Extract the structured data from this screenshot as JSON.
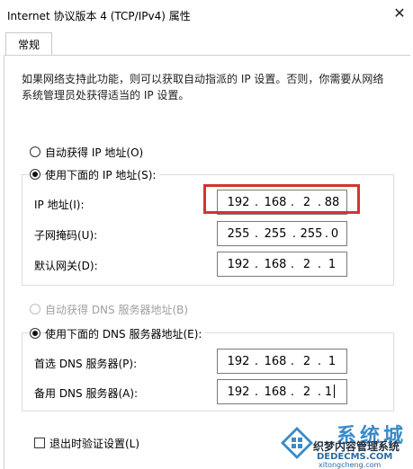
{
  "window": {
    "title": "Internet 协议版本 4 (TCP/IPv4) 属性",
    "close_glyph": "✕"
  },
  "tabs": [
    {
      "label": "常规",
      "selected": true
    }
  ],
  "description": "如果网络支持此功能，则可以获取自动指派的 IP 设置。否则，你需要从网络系统管理员处获得适当的 IP 设置。",
  "ip_section": {
    "auto_radio": {
      "label": "自动获得 IP 地址(O)",
      "checked": false
    },
    "manual_radio": {
      "label": "使用下面的 IP 地址(S):",
      "checked": true
    },
    "fields": [
      {
        "label": "IP 地址(I):",
        "octets": [
          "192",
          "168",
          "2",
          "88"
        ],
        "highlighted": true
      },
      {
        "label": "子网掩码(U):",
        "octets": [
          "255",
          "255",
          "255",
          "0"
        ],
        "highlighted": false
      },
      {
        "label": "默认网关(D):",
        "octets": [
          "192",
          "168",
          "2",
          "1"
        ],
        "highlighted": false
      }
    ]
  },
  "dns_section": {
    "auto_radio": {
      "label": "自动获得 DNS 服务器地址(B)",
      "checked": false,
      "disabled": true
    },
    "manual_radio": {
      "label": "使用下面的 DNS 服务器地址(E):",
      "checked": true
    },
    "fields": [
      {
        "label": "首选 DNS 服务器(P):",
        "octets": [
          "192",
          "168",
          "2",
          "1"
        ]
      },
      {
        "label": "备用 DNS 服务器(A):",
        "octets": [
          "192",
          "168",
          "2",
          "1"
        ]
      }
    ]
  },
  "validate_checkbox": {
    "label": "退出时验证设置(L)",
    "checked": false
  },
  "watermark": {
    "line1": "系统城",
    "line2": "织梦内容管理系统",
    "line3": "DEDECMS.COM",
    "line4": "xitongcheng.com"
  },
  "colors": {
    "highlight": "#d2352f",
    "watermark_blue": "#3a8bc8"
  }
}
